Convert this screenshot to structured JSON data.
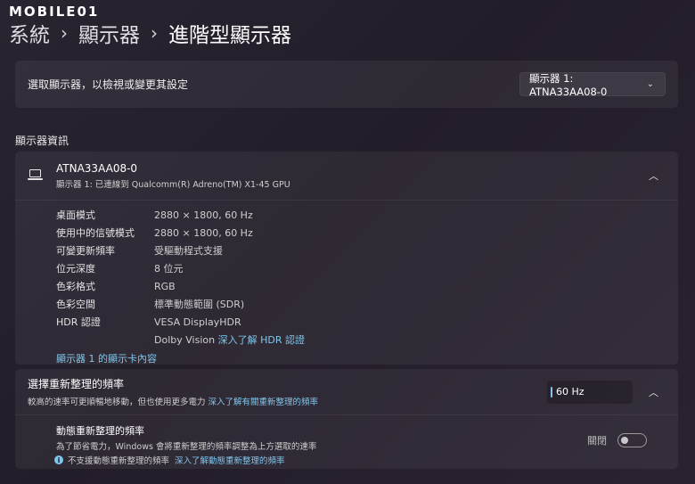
{
  "watermark": "MOBILE01",
  "breadcrumb": [
    "系統",
    "顯示器",
    "進階型顯示器"
  ],
  "select_display": {
    "label": "選取顯示器，以檢視或變更其設定",
    "selected": "顯示器 1: ATNA33AA08-0"
  },
  "display_info": {
    "section_title": "顯示器資訊",
    "name": "ATNA33AA08-0",
    "subtitle": "顯示器 1: 已連線到 Qualcomm(R) Adreno(TM) X1-45 GPU",
    "properties": [
      {
        "key": "桌面模式",
        "value": "2880 × 1800, 60 Hz"
      },
      {
        "key": "使用中的信號模式",
        "value": "2880 × 1800, 60 Hz"
      },
      {
        "key": "可變更新頻率",
        "value": "受驅動程式支援"
      },
      {
        "key": "位元深度",
        "value": "8 位元"
      },
      {
        "key": "色彩格式",
        "value": "RGB"
      },
      {
        "key": "色彩空間",
        "value": "標準動態範圍 (SDR)"
      }
    ],
    "hdr": {
      "key": "HDR 認證",
      "value1": "VESA DisplayHDR",
      "value2": "Dolby Vision",
      "link": "深入了解 HDR 認證"
    },
    "adapter_link": "顯示器 1 的顯示卡內容"
  },
  "refresh_rate": {
    "title": "選擇重新整理的頻率",
    "desc": "較高的速率可更順暢地移動，但也使用更多電力",
    "link": "深入了解有關重新整理的頻率",
    "value": "60 Hz",
    "dynamic": {
      "title": "動態重新整理的頻率",
      "desc": "為了節省電力，Windows 會將重新整理的頻率調整為上方選取的速率",
      "warning": "不支援動態重新整理的頻率",
      "warning_link": "深入了解動態重新整理的頻率",
      "toggle_label": "關閉",
      "toggle_on": false
    }
  },
  "colors": {
    "accent": "#7fc6ec",
    "background": "#251f2b"
  }
}
